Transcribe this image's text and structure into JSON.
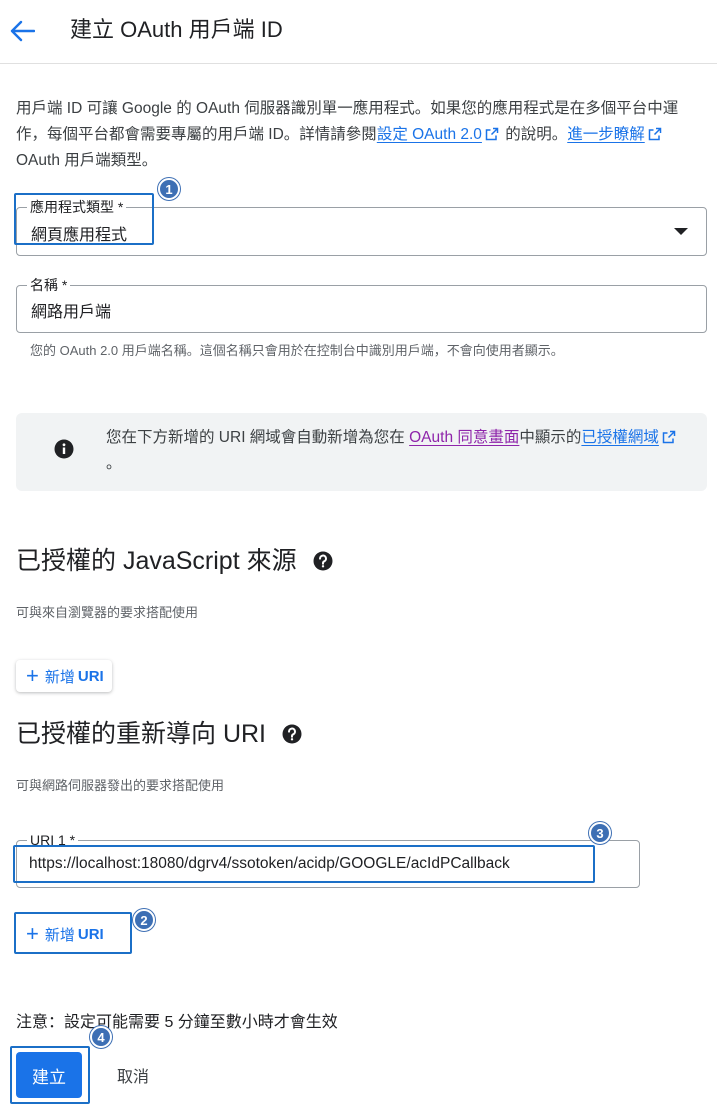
{
  "header": {
    "title": "建立 OAuth 用戶端 ID",
    "back_icon": "arrow-back-icon"
  },
  "intro": {
    "text1": "用戶端 ID 可讓 Google 的 OAuth 伺服器識別單一應用程式。如果您的應用程式是在多個平台中運作，每個平台都會需要專屬的用戶端 ID。詳情請參閱",
    "link1": "設定 OAuth 2.0",
    "text2": " 的說明。",
    "link2": "進一步瞭解",
    "text3": " OAuth 用戶端類型。"
  },
  "app_type": {
    "label": "應用程式類型 *",
    "value": "網頁應用程式"
  },
  "name": {
    "label": "名稱 *",
    "value": "網路用戶端",
    "hint": "您的 OAuth 2.0 用戶端名稱。這個名稱只會用於在控制台中識別用戶端，不會向使用者顯示。"
  },
  "info": {
    "text1": "您在下方新增的 URI 網域會自動新增為您在 ",
    "link1": "OAuth 同意畫面",
    "text2": "中顯示的",
    "link2": "已授權網域",
    "text3": "。"
  },
  "js_origins": {
    "title": "已授權的 JavaScript 來源",
    "desc": "可與來自瀏覽器的要求搭配使用",
    "add_label": "新增",
    "add_suffix": "URI"
  },
  "redirect": {
    "title": "已授權的重新導向 URI",
    "desc": "可與網路伺服器發出的要求搭配使用",
    "uri_label": "URI 1 *",
    "uri_value": "https://localhost:18080/dgrv4/ssotoken/acidp/GOOGLE/acIdPCallback",
    "add_label": "新增",
    "add_suffix": "URI"
  },
  "note": "注意：設定可能需要 5 分鐘至數小時才會生效",
  "actions": {
    "create": "建立",
    "cancel": "取消"
  },
  "badges": [
    "1",
    "2",
    "3",
    "4"
  ],
  "colors": {
    "accent": "#1a73e8",
    "highlight": "#1b6fc7",
    "badge": "#3d6fb4",
    "visited_link": "#8e24aa"
  }
}
